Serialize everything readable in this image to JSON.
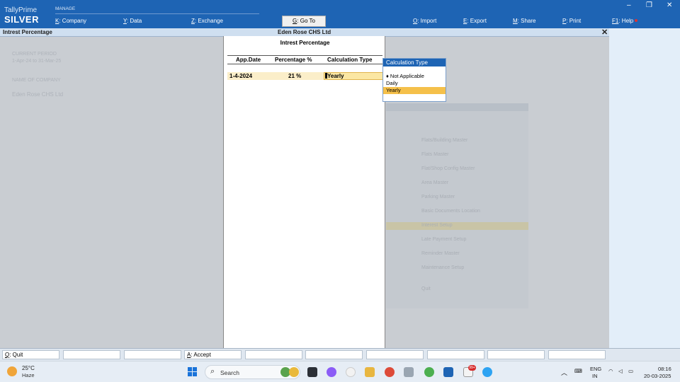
{
  "app": {
    "brand_top": "TallyPrime",
    "brand_edition": "SILVER",
    "section_label": "MANAGE"
  },
  "topmenu": {
    "company": {
      "key": "K",
      "label": ": Company"
    },
    "data": {
      "key": "Y",
      "label": ": Data"
    },
    "exchange": {
      "key": "Z",
      "label": ": Exchange"
    },
    "goto": {
      "key": "G",
      "label": ": Go To"
    },
    "import": {
      "key": "O",
      "label": ": Import"
    },
    "export": {
      "key": "E",
      "label": ": Export"
    },
    "share": {
      "key": "M",
      "label": ": Share"
    },
    "print": {
      "key": "P",
      "label": ": Print"
    },
    "help": {
      "key": "F1",
      "label": ": Help"
    }
  },
  "window_controls": {
    "minimize": "–",
    "restore": "❐",
    "close": "✕"
  },
  "screen": {
    "title": "Intrest Percentage",
    "company": "Eden Rose CHS Ltd",
    "close_glyph": "✕"
  },
  "background": {
    "period_label": "CURRENT PERIOD",
    "period_value": "1-Apr-24 to 31-Mar-25",
    "company_label": "NAME OF COMPANY",
    "company_value": "Eden Rose CHS Ltd",
    "gateway_items": [
      "Flats/Building Master",
      "Flats Master",
      "Flat/Shop Config Master",
      "Area Master",
      "Parking Master",
      "Basic Documents Location",
      "Interest Setup",
      "Late Payment Setup",
      "Reminder Master",
      "Maintenance Setup",
      "Quit"
    ]
  },
  "dialog": {
    "title": "Intrest Percentage",
    "columns": [
      "App.Date",
      "Percentage %",
      "Calculation Type"
    ],
    "rows": [
      {
        "app_date": "1-4-2024",
        "percentage": "21 %",
        "calculation_type": "Yearly"
      }
    ]
  },
  "calc_type_list": {
    "title": "Calculation Type",
    "options": [
      "Not Applicable",
      "Daily",
      "Yearly"
    ],
    "selected": "Yearly",
    "marker": "♦"
  },
  "function_bar": {
    "quit": {
      "key": "Q",
      "label": ": Quit"
    },
    "accept": {
      "key": "A",
      "label": ": Accept"
    }
  },
  "taskbar": {
    "temperature": "25°C",
    "weather": "Haze",
    "search_placeholder": "Search",
    "language_line1": "ENG",
    "language_line2": "IN",
    "time": "08:16",
    "date": "20-03-2025",
    "mail_badge": "99+"
  },
  "colors": {
    "accent_blue": "#1e64b4",
    "selection_yellow": "#f5c04a",
    "row_highlight": "#fbeec9"
  }
}
